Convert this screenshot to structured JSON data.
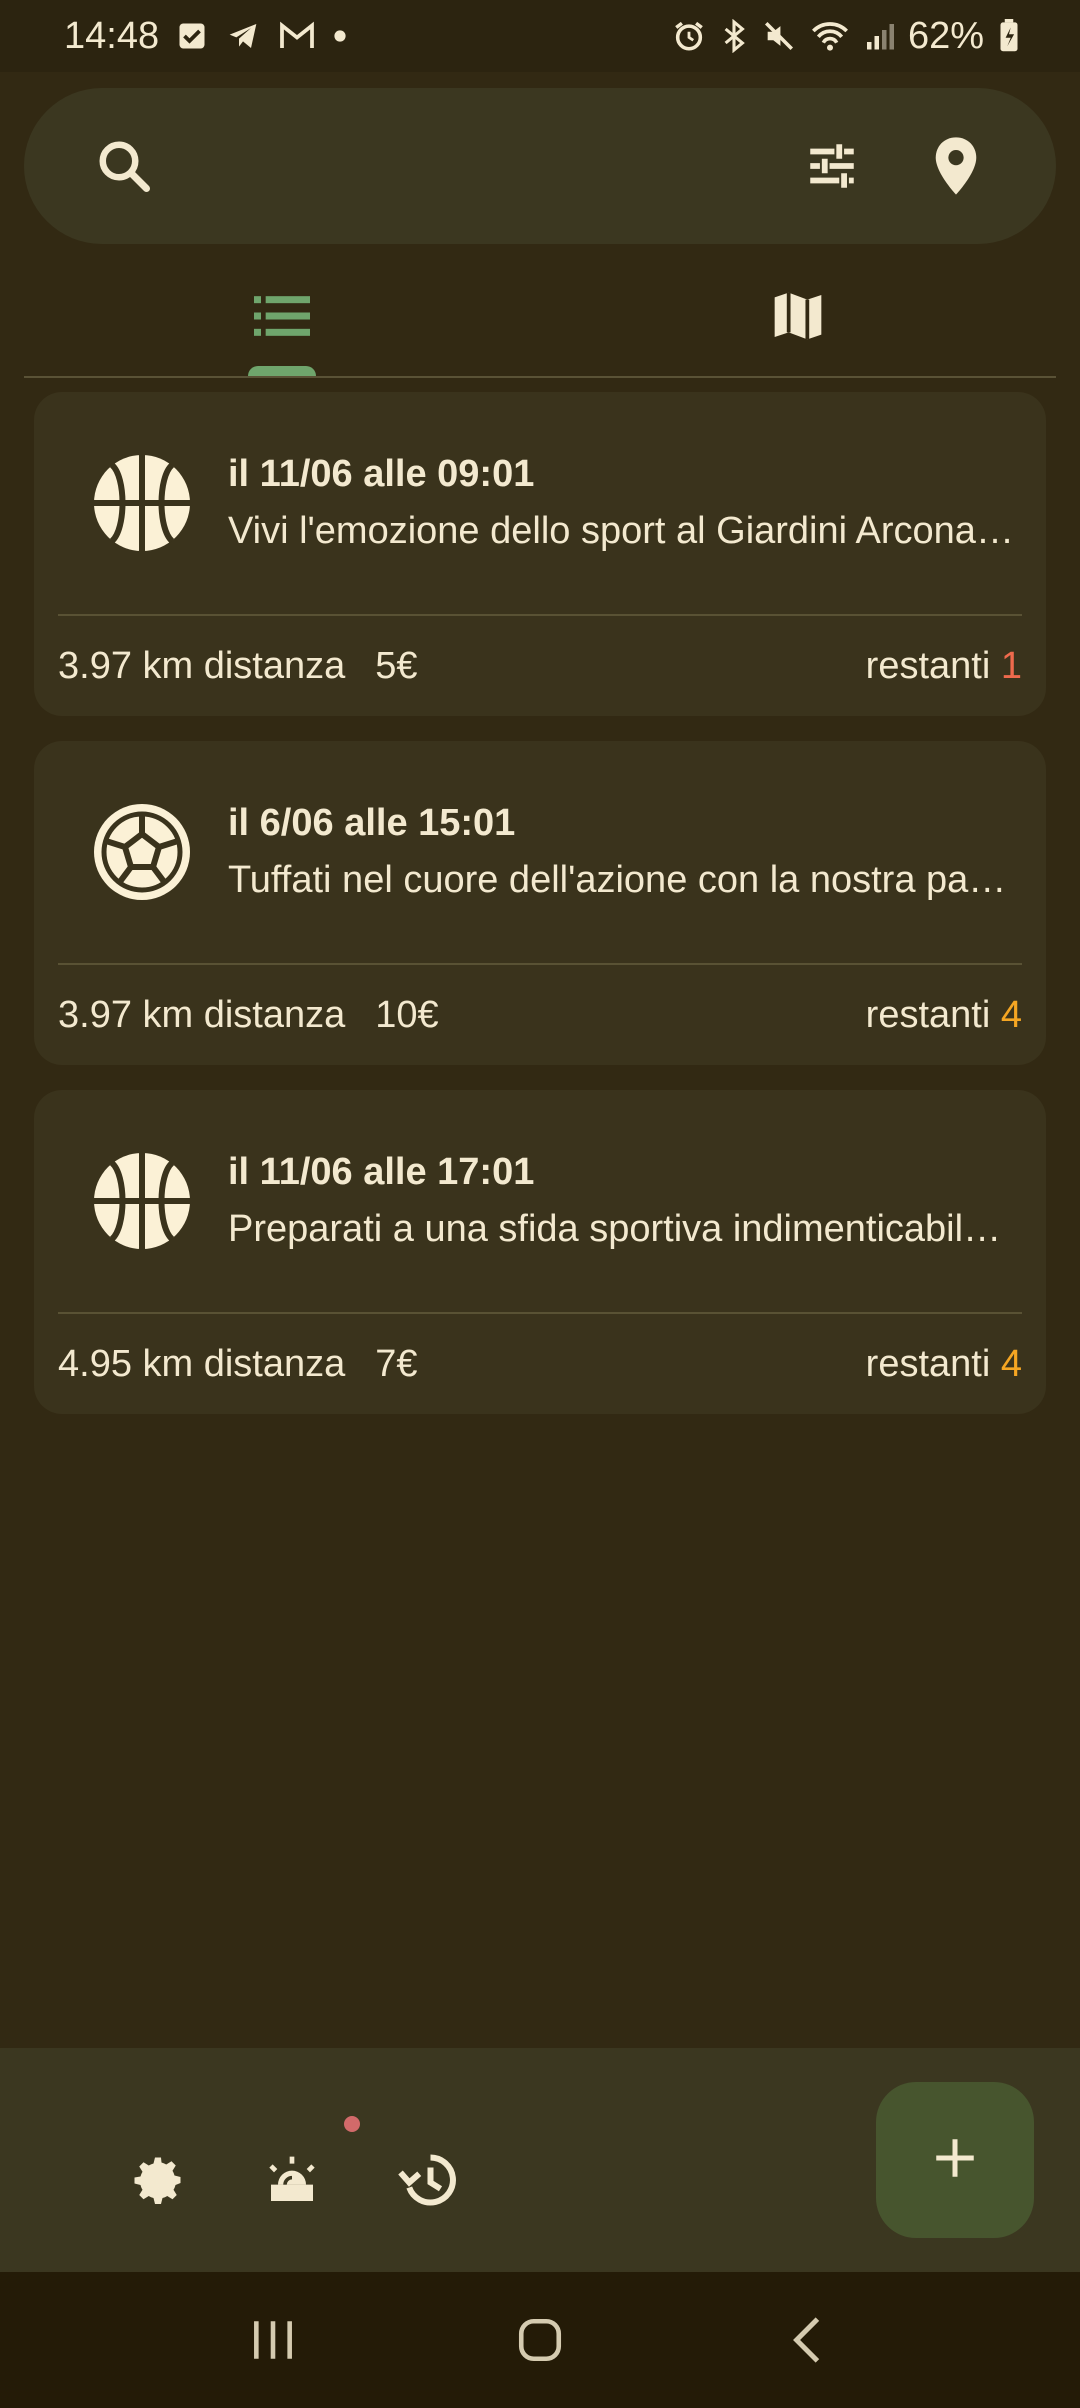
{
  "status_bar": {
    "time": "14:48",
    "battery": "62%",
    "left_icons": [
      "checkbox-icon",
      "telegram-icon",
      "gmail-icon",
      "dot-icon"
    ],
    "right_icons": [
      "alarm-icon",
      "bluetooth-icon",
      "mute-icon",
      "wifi-icon",
      "signal-icon",
      "battery-icon"
    ]
  },
  "search": {
    "placeholder": "",
    "value": "",
    "icons": [
      "search-icon",
      "filter-icon",
      "location-pin-icon"
    ]
  },
  "tabs": [
    {
      "name": "list",
      "icon": "list-icon",
      "active": true
    },
    {
      "name": "map",
      "icon": "map-icon",
      "active": false
    }
  ],
  "events": [
    {
      "sport_icon": "basketball-icon",
      "date": "il 11/06 alle 09:01",
      "description": "Vivi l'emozione dello sport al Giardini Arconati a Milano",
      "distance": "3.97 km distanza",
      "price": "5€",
      "remaining_label": "restanti",
      "remaining": "1",
      "remaining_color": "#ee6a4d"
    },
    {
      "sport_icon": "soccer-ball-icon",
      "date": "il 6/06 alle 15:01",
      "description": "Tuffati nel cuore dell'azione con la nostra partita di calcetto",
      "distance": "3.97 km distanza",
      "price": "10€",
      "remaining_label": "restanti",
      "remaining": "4",
      "remaining_color": "#f5a623"
    },
    {
      "sport_icon": "basketball-icon",
      "date": "il 11/06 alle 17:01",
      "description": "Preparati a una sfida sportiva indimenticabile al campo",
      "distance": "4.95 km distanza",
      "price": "7€",
      "remaining_label": "restanti",
      "remaining": "4",
      "remaining_color": "#f5a623"
    }
  ],
  "bottom_bar": {
    "icons": [
      "settings-icon",
      "alarm-light-icon",
      "history-icon"
    ],
    "fab_icon": "plus-icon"
  },
  "nav_bar": {
    "icons": [
      "recent-apps-icon",
      "home-icon",
      "back-icon"
    ]
  },
  "colors": {
    "background": "#322913",
    "surface": "#3a331c",
    "accent": "#6fa56c",
    "text": "#f3e9cf"
  }
}
